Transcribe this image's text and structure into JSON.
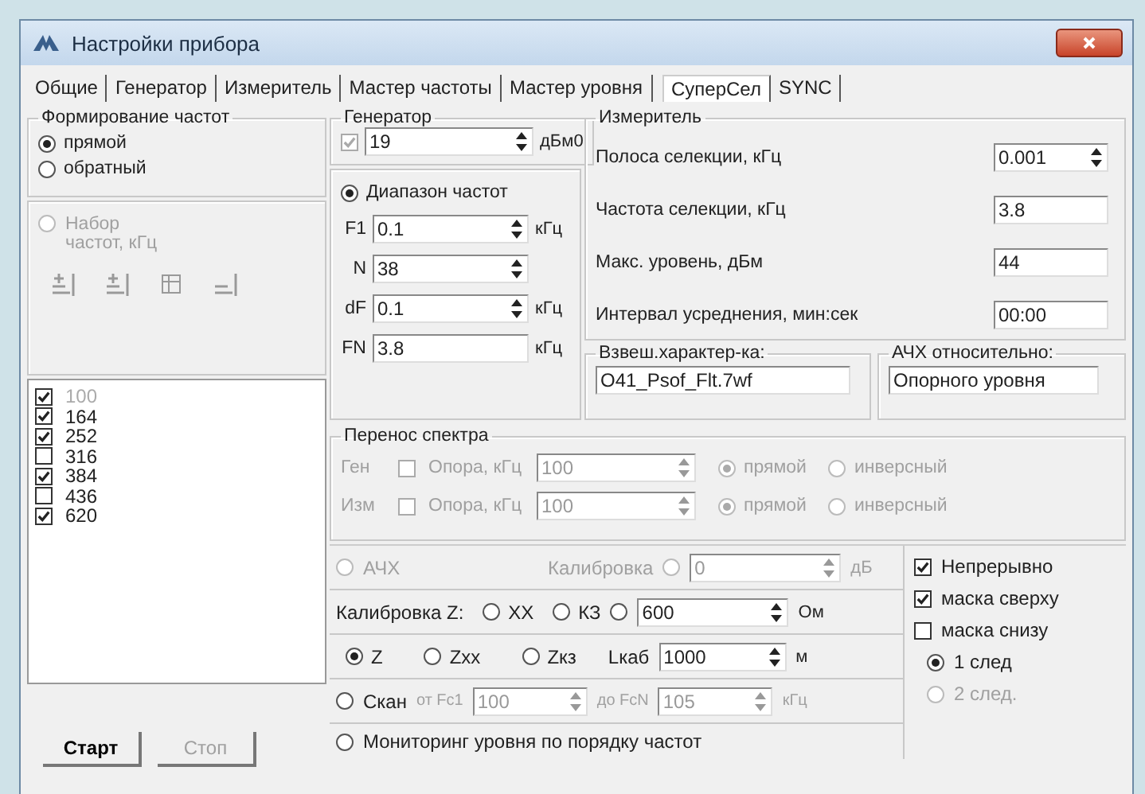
{
  "window": {
    "title": "Настройки прибора"
  },
  "tabs": [
    {
      "label": "Общие",
      "selected": false
    },
    {
      "label": "Генератор",
      "selected": false
    },
    {
      "label": "Измеритель",
      "selected": false
    },
    {
      "label": "Мастер частоты",
      "selected": false
    },
    {
      "label": "Мастер уровня",
      "selected": false
    },
    {
      "label": "СуперСел",
      "selected": true
    },
    {
      "label": "SYNC",
      "selected": false
    }
  ],
  "freq_forming": {
    "title": "Формирование частот",
    "options": [
      {
        "label": "прямой",
        "selected": true
      },
      {
        "label": "обратный",
        "selected": false
      }
    ]
  },
  "freq_set": {
    "label": "Набор частот, кГц",
    "selected": false,
    "disabled": true
  },
  "freq_list": [
    {
      "value": "100",
      "checked": true,
      "selected": true
    },
    {
      "value": "164",
      "checked": true,
      "selected": false
    },
    {
      "value": "252",
      "checked": true,
      "selected": false
    },
    {
      "value": "316",
      "checked": false,
      "selected": false
    },
    {
      "value": "384",
      "checked": true,
      "selected": false
    },
    {
      "value": "436",
      "checked": false,
      "selected": false
    },
    {
      "value": "620",
      "checked": true,
      "selected": false
    }
  ],
  "buttons": [
    {
      "label": "Старт",
      "disabled": false
    },
    {
      "label": "Стоп",
      "disabled": true
    }
  ],
  "generator": {
    "title": "Генератор",
    "checked": true,
    "disabled": true,
    "value": "19",
    "unit": "дБм0"
  },
  "range": {
    "title": "Диапазон частот",
    "selected": true,
    "fields": [
      {
        "label": "F1",
        "value": "0.1",
        "unit": "кГц",
        "kind": "spin"
      },
      {
        "label": "N",
        "value": "38",
        "kind": "spin"
      },
      {
        "label": "dF",
        "value": "0.1",
        "unit": "кГц",
        "kind": "spin"
      },
      {
        "label": "FN",
        "value": "3.8",
        "unit": "кГц",
        "kind": "text"
      }
    ]
  },
  "meter": {
    "title": "Измеритель",
    "fields": [
      {
        "label": "Полоса селекции, кГц",
        "value": "0.001",
        "kind": "spin"
      },
      {
        "label": "Частота селекции, кГц",
        "value": "3.8",
        "kind": "text"
      },
      {
        "label": "Макс. уровень, дБм",
        "value": "44",
        "kind": "text"
      },
      {
        "label": "Интервал усреднения, мин:сек",
        "value": "00:00",
        "kind": "text"
      }
    ]
  },
  "weighting": {
    "title": "Взвеш.характер-ка:",
    "value": "O41_Psof_Flt.7wf"
  },
  "afc_relative": {
    "title": "АЧХ относительно:",
    "value": "Опорного уровня"
  },
  "spectrum_shift": {
    "title": "Перенос спектра",
    "rows": [
      {
        "label": "Ген",
        "check_label": "Опора, кГц",
        "checked": false,
        "disabled": true,
        "value": "100",
        "options": [
          {
            "label": "прямой",
            "selected": true
          },
          {
            "label": "инверсный",
            "selected": false
          }
        ]
      },
      {
        "label": "Изм",
        "check_label": "Опора, кГц",
        "checked": false,
        "disabled": true,
        "value": "100",
        "options": [
          {
            "label": "прямой",
            "selected": true
          },
          {
            "label": "инверсный",
            "selected": false
          }
        ]
      }
    ]
  },
  "afc_row": {
    "label": "АЧХ",
    "selected": false,
    "calib_label": "Калибровка",
    "calib_selected": false,
    "value": "0",
    "unit": "дБ",
    "disabled": true
  },
  "z_calibration": {
    "label": "Калибровка Z:",
    "options": [
      {
        "label": "ХХ",
        "selected": false
      },
      {
        "label": "КЗ",
        "selected": false
      }
    ],
    "custom_selected": false,
    "value": "600",
    "unit": "Ом"
  },
  "z_mode": {
    "options": [
      {
        "label": "Z",
        "selected": true
      },
      {
        "label": "Zxx",
        "selected": false
      },
      {
        "label": "Zкз",
        "selected": false
      }
    ],
    "cable_label": "Lкаб",
    "value": "1000",
    "unit": "м"
  },
  "scan": {
    "label": "Скан",
    "selected": false,
    "range_disabled": true,
    "from_label": "от Fс1",
    "from_value": "100",
    "to_label": "до FсN",
    "to_value": "105",
    "unit": "кГц"
  },
  "monitoring": {
    "label": "Мониторинг  уровня по порядку частот",
    "selected": false
  },
  "options": [
    {
      "kind": "checkbox",
      "label": "Непрерывно",
      "checked": true,
      "disabled": false
    },
    {
      "kind": "checkbox",
      "label": "маска сверху",
      "checked": true,
      "disabled": false
    },
    {
      "kind": "checkbox",
      "label": "маска снизу",
      "checked": false,
      "disabled": false
    },
    {
      "kind": "radio",
      "label": "1 след",
      "selected": true,
      "disabled": false
    },
    {
      "kind": "radio",
      "label": "2 след.",
      "selected": false,
      "disabled": true
    }
  ]
}
